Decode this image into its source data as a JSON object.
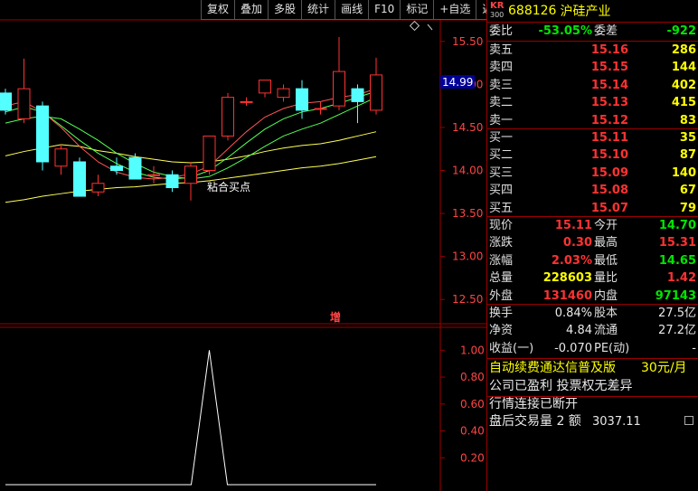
{
  "toolbar": {
    "items": [
      "复权",
      "叠加",
      "多股",
      "统计",
      "画线",
      "F10",
      "标记",
      "+自选",
      "返回"
    ]
  },
  "price_axis": {
    "ticks": [
      "15.50",
      "15.00",
      "14.50",
      "14.00",
      "13.50",
      "13.00",
      "12.50"
    ],
    "current_price_tag": "14.99"
  },
  "indicator_axis": {
    "ticks": [
      "1.00",
      "0.80",
      "0.60",
      "0.40",
      "0.20"
    ]
  },
  "annotations": {
    "signal_label": "粘合买点",
    "increase_marker": "增"
  },
  "colors": {
    "up": "#ff3232",
    "down": "#54ffff",
    "grid_border": "#9b0000",
    "ma_yellow": "#ffff54",
    "ma_green": "#54ff54",
    "ma_red": "#ff5454"
  },
  "chart_data": {
    "type": "candlestick",
    "title": "",
    "ylim": [
      12.25,
      15.75
    ],
    "candles": [
      {
        "o": 14.9,
        "h": 14.95,
        "l": 14.65,
        "c": 14.7
      },
      {
        "o": 14.6,
        "h": 15.3,
        "l": 14.55,
        "c": 14.95
      },
      {
        "o": 14.75,
        "h": 14.8,
        "l": 14.0,
        "c": 14.1
      },
      {
        "o": 14.05,
        "h": 14.3,
        "l": 13.95,
        "c": 14.25
      },
      {
        "o": 14.1,
        "h": 14.15,
        "l": 13.7,
        "c": 13.7
      },
      {
        "o": 13.75,
        "h": 13.95,
        "l": 13.7,
        "c": 13.85
      },
      {
        "o": 14.05,
        "h": 14.15,
        "l": 13.95,
        "c": 14.0
      },
      {
        "o": 14.15,
        "h": 14.2,
        "l": 13.9,
        "c": 13.9
      },
      {
        "o": 13.95,
        "h": 14.05,
        "l": 13.85,
        "c": 13.95
      },
      {
        "o": 13.95,
        "h": 14.0,
        "l": 13.75,
        "c": 13.8
      },
      {
        "o": 13.85,
        "h": 14.1,
        "l": 13.65,
        "c": 14.05
      },
      {
        "o": 14.0,
        "h": 14.4,
        "l": 13.95,
        "c": 14.4
      },
      {
        "o": 14.4,
        "h": 14.9,
        "l": 14.35,
        "c": 14.85
      },
      {
        "o": 14.8,
        "h": 14.85,
        "l": 14.75,
        "c": 14.8
      },
      {
        "o": 14.9,
        "h": 15.05,
        "l": 14.85,
        "c": 15.05
      },
      {
        "o": 14.85,
        "h": 15.0,
        "l": 14.8,
        "c": 14.95
      },
      {
        "o": 14.95,
        "h": 15.05,
        "l": 14.6,
        "c": 14.7
      },
      {
        "o": 14.72,
        "h": 14.8,
        "l": 14.65,
        "c": 14.72
      },
      {
        "o": 14.75,
        "h": 15.55,
        "l": 14.7,
        "c": 15.15
      },
      {
        "o": 14.95,
        "h": 15.0,
        "l": 14.55,
        "c": 14.8
      },
      {
        "o": 14.7,
        "h": 15.31,
        "l": 14.65,
        "c": 15.11
      }
    ],
    "ma_series": [
      {
        "color": "#ffff54",
        "values": [
          13.63,
          13.66,
          13.7,
          13.73,
          13.76,
          13.78,
          13.8,
          13.81,
          13.83,
          13.85,
          13.86,
          13.88,
          13.91,
          13.94,
          13.97,
          14.0,
          14.03,
          14.05,
          14.08,
          14.12,
          14.16
        ]
      },
      {
        "color": "#ffff54",
        "values": [
          14.17,
          14.22,
          14.26,
          14.3,
          14.28,
          14.23,
          14.2,
          14.16,
          14.13,
          14.1,
          14.09,
          14.1,
          14.13,
          14.17,
          14.22,
          14.26,
          14.29,
          14.31,
          14.35,
          14.4,
          14.45
        ]
      },
      {
        "color": "#54ff54",
        "values": [
          14.55,
          14.6,
          14.63,
          14.6,
          14.48,
          14.35,
          14.2,
          14.08,
          13.98,
          13.93,
          13.9,
          13.93,
          14.03,
          14.15,
          14.28,
          14.4,
          14.48,
          14.55,
          14.65,
          14.75,
          14.85
        ]
      },
      {
        "color": "#54ff54",
        "values": [
          14.68,
          14.74,
          14.68,
          14.52,
          14.35,
          14.2,
          14.08,
          13.98,
          13.92,
          13.9,
          13.92,
          14.0,
          14.15,
          14.32,
          14.48,
          14.6,
          14.68,
          14.72,
          14.78,
          14.85,
          14.92
        ]
      },
      {
        "color": "#ff5454",
        "values": [
          14.75,
          14.8,
          14.68,
          14.5,
          14.28,
          14.1,
          13.98,
          13.92,
          13.9,
          13.92,
          13.96,
          14.05,
          14.25,
          14.45,
          14.62,
          14.72,
          14.78,
          14.8,
          14.85,
          14.88,
          14.95
        ]
      }
    ],
    "indicator": {
      "ylim": [
        0,
        1.15
      ],
      "values": [
        0,
        0,
        0,
        0,
        0,
        0,
        0,
        0,
        0,
        0,
        0,
        1,
        0,
        0,
        0,
        0,
        0,
        0,
        0,
        0,
        0
      ]
    }
  },
  "quote": {
    "badge_top": "KR",
    "badge_bottom": "300",
    "code": "688126",
    "name": "沪硅产业",
    "ratio_label": "委比",
    "ratio_value": "-53.05%",
    "diff_label": "委差",
    "diff_value": "-922",
    "asks": [
      {
        "label": "卖五",
        "price": "15.16",
        "vol": "286"
      },
      {
        "label": "卖四",
        "price": "15.15",
        "vol": "144"
      },
      {
        "label": "卖三",
        "price": "15.14",
        "vol": "402"
      },
      {
        "label": "卖二",
        "price": "15.13",
        "vol": "415"
      },
      {
        "label": "卖一",
        "price": "15.12",
        "vol": "83"
      }
    ],
    "bids": [
      {
        "label": "买一",
        "price": "15.11",
        "vol": "35"
      },
      {
        "label": "买二",
        "price": "15.10",
        "vol": "87"
      },
      {
        "label": "买三",
        "price": "15.09",
        "vol": "140"
      },
      {
        "label": "买四",
        "price": "15.08",
        "vol": "67"
      },
      {
        "label": "买五",
        "price": "15.07",
        "vol": "79"
      }
    ],
    "stats": [
      {
        "l1": "现价",
        "v1": "15.11",
        "c1": "red",
        "l2": "今开",
        "v2": "14.70",
        "c2": "green"
      },
      {
        "l1": "涨跌",
        "v1": "0.30",
        "c1": "red",
        "l2": "最高",
        "v2": "15.31",
        "c2": "red"
      },
      {
        "l1": "涨幅",
        "v1": "2.03%",
        "c1": "red",
        "l2": "最低",
        "v2": "14.65",
        "c2": "green"
      },
      {
        "l1": "总量",
        "v1": "228603",
        "c1": "yellow",
        "l2": "量比",
        "v2": "1.42",
        "c2": "red"
      },
      {
        "l1": "外盘",
        "v1": "131460",
        "c1": "red",
        "l2": "内盘",
        "v2": "97143",
        "c2": "green"
      }
    ],
    "fin": [
      {
        "l1": "换手",
        "v1": "0.84%",
        "l2": "股本",
        "v2": "27.5亿"
      },
      {
        "l1": "净资",
        "v1": "4.84",
        "l2": "流通",
        "v2": "27.2亿"
      },
      {
        "l1": "收益(一)",
        "v1": "-0.070",
        "l2": "PE(动)",
        "v2": "-"
      }
    ],
    "promo1": "自动续费通达信普及版",
    "promo1_price": "30元/月",
    "promo2": "公司已盈利 投票权无差异",
    "status1": "行情连接已断开",
    "status2_label": "盘后交易量 2 额",
    "status2_value": "3037.11"
  }
}
